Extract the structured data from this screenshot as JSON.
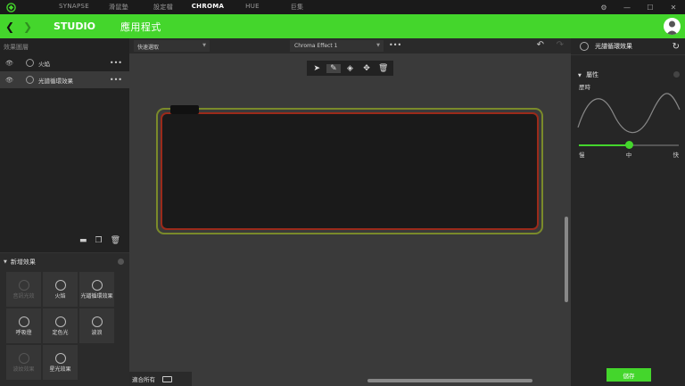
{
  "topnav": {
    "items": [
      "SYNAPSE",
      "滑鼠墊",
      "設定檔",
      "CHROMA",
      "HUE",
      "巨集"
    ],
    "active_index": 3
  },
  "window_controls": [
    "gear-icon",
    "minimize-icon",
    "maximize-icon",
    "close-icon"
  ],
  "header": {
    "title": "STUDIO",
    "subtitle": "應用程式"
  },
  "layers_panel": {
    "title": "效果圖層",
    "layers": [
      {
        "label": "火焰",
        "selected": false
      },
      {
        "label": "光譜循環效果",
        "selected": true
      }
    ]
  },
  "add_effects": {
    "title": "新增效果",
    "effects": [
      {
        "label": "音訊光效",
        "enabled": false
      },
      {
        "label": "火焰",
        "enabled": true
      },
      {
        "label": "光譜循環效果",
        "enabled": true
      },
      {
        "label": "呼吸燈",
        "enabled": true
      },
      {
        "label": "定色光",
        "enabled": true
      },
      {
        "label": "波浪",
        "enabled": true
      },
      {
        "label": "波紋效果",
        "enabled": false
      },
      {
        "label": "星光效果",
        "enabled": true
      }
    ]
  },
  "canvas": {
    "quick_select": "快速選取",
    "effect_name": "Chroma Effect 1",
    "fit_all": "適合所有"
  },
  "properties_panel": {
    "title": "光譜循環效果",
    "section": "屬性",
    "duration_label": "歷時",
    "slider": {
      "min_label": "慢",
      "mid_label": "中",
      "max_label": "快",
      "value": 0.5
    },
    "save_label": "儲存"
  },
  "colors": {
    "accent": "#44d62c"
  }
}
